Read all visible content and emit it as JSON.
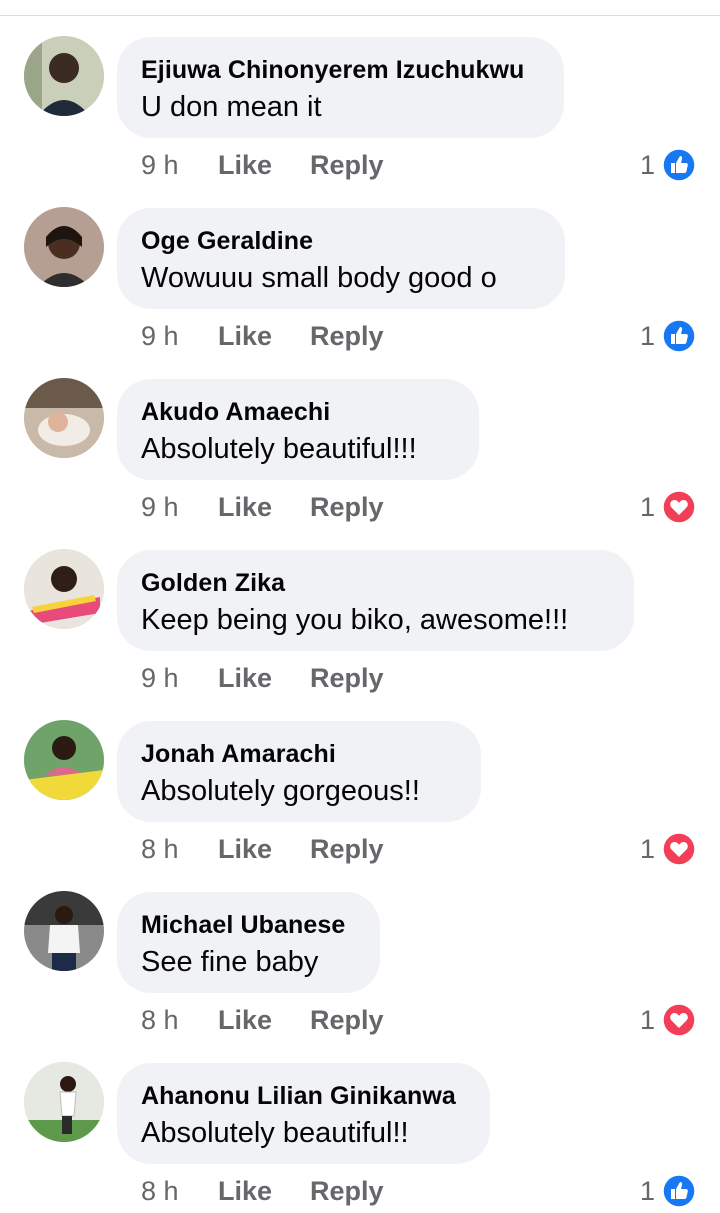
{
  "colors": {
    "bubble": "#f0f2f5",
    "meta_text": "#65676b",
    "like_blue": "#1877f2",
    "love_red": "#f33e58"
  },
  "comments": [
    {
      "author": "Ejiuwa Chinonyerem Izuchukwu",
      "text": "U don mean it",
      "time": "9 h",
      "like_label": "Like",
      "reply_label": "Reply",
      "reaction_count": "1",
      "reaction": "like-icon",
      "avatar_color": "#8a9a7a"
    },
    {
      "author": "Oge Geraldine",
      "text": "Wowuuu small body good o",
      "time": "9 h",
      "like_label": "Like",
      "reply_label": "Reply",
      "reaction_count": "1",
      "reaction": "like-icon",
      "avatar_color": "#7a6a66"
    },
    {
      "author": "Akudo Amaechi",
      "text": "Absolutely beautiful!!!",
      "time": "9 h",
      "like_label": "Like",
      "reply_label": "Reply",
      "reaction_count": "1",
      "reaction": "love-icon",
      "avatar_color": "#b3a59a"
    },
    {
      "author": "Golden Zika",
      "text": "Keep being you biko, awesome!!!",
      "time": "9 h",
      "like_label": "Like",
      "reply_label": "Reply",
      "reaction_count": "",
      "reaction": "",
      "avatar_color": "#d98a6a"
    },
    {
      "author": "Jonah Amarachi",
      "text": "Absolutely gorgeous!!",
      "time": "8 h",
      "like_label": "Like",
      "reply_label": "Reply",
      "reaction_count": "1",
      "reaction": "love-icon",
      "avatar_color": "#4f8a4a"
    },
    {
      "author": "Michael Ubanese",
      "text": "See fine baby",
      "time": "8 h",
      "like_label": "Like",
      "reply_label": "Reply",
      "reaction_count": "1",
      "reaction": "love-icon",
      "avatar_color": "#5a5a5a"
    },
    {
      "author": "Ahanonu Lilian Ginikanwa",
      "text": "Absolutely beautiful!!",
      "time": "8 h",
      "like_label": "Like",
      "reply_label": "Reply",
      "reaction_count": "1",
      "reaction": "like-icon",
      "avatar_color": "#8fa58a"
    }
  ]
}
